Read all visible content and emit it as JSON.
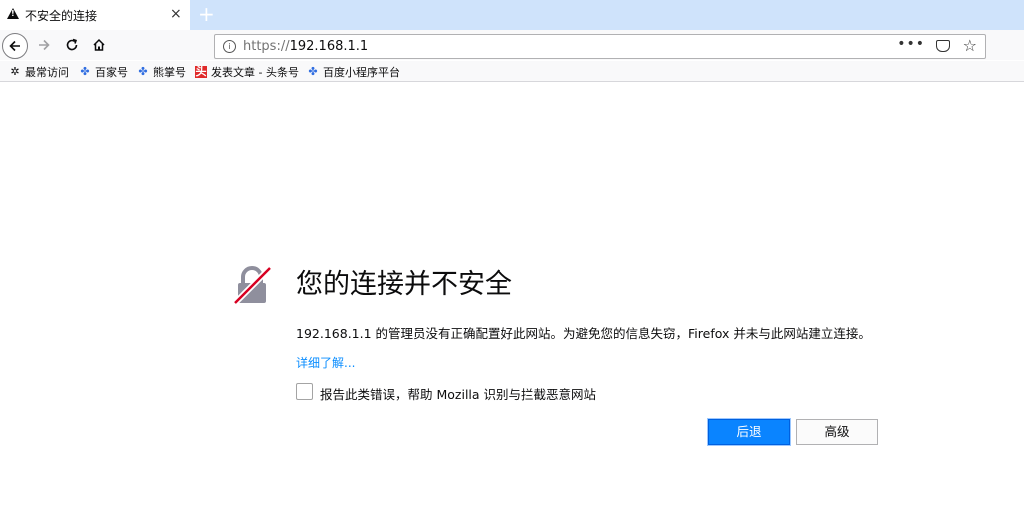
{
  "tab": {
    "title": "不安全的连接",
    "close": "×"
  },
  "newtab": "+",
  "url": {
    "protocol": "https://",
    "host": "192.168.1.1",
    "dots": "•••"
  },
  "bookmarks": [
    {
      "label": "最常访问",
      "icon": "gear-icon"
    },
    {
      "label": "百家号",
      "icon": "baidu-paw-icon"
    },
    {
      "label": "熊掌号",
      "icon": "baidu-paw-icon"
    },
    {
      "label": "发表文章 - 头条号",
      "icon": "toutiao-icon",
      "glyph": "头"
    },
    {
      "label": "百度小程序平台",
      "icon": "baidu-paw-icon"
    }
  ],
  "error": {
    "title": "您的连接并不安全",
    "description": "192.168.1.1 的管理员没有正确配置好此网站。为避免您的信息失窃，Firefox 并未与此网站建立连接。",
    "learn_more": "详细了解...",
    "report_label": "报告此类错误，帮助 Mozilla 识别与拦截恶意网站",
    "back_button": "后退",
    "advanced_button": "高级"
  },
  "colors": {
    "accent": "#0a84ff",
    "link": "#0a8dff",
    "lock_slash": "#d70022"
  }
}
